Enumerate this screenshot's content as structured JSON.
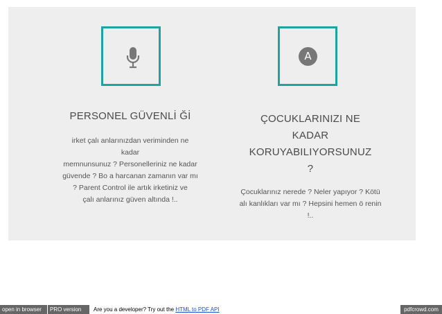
{
  "colors": {
    "accent": "#1fa3a0",
    "panel_bg": "#eeeeee",
    "title": "#4a4a4a",
    "footer_bg": "#666666"
  },
  "cards": [
    {
      "icon": "microphone-icon",
      "title": "PERSONEL GÜVENLİ Ğİ",
      "description_lines": [
        "irket çalı anlarınızdan veriminden ne kadar",
        "memnunsunuz ? Personelleriniz ne kadar",
        "güvende ? Bo a harcanan zamanın var mı",
        "? Parent Control ile artık irketiniz ve",
        "çalı anlarınız güven altında !.."
      ]
    },
    {
      "icon": "avatar-a-icon",
      "icon_letter": "A",
      "title_lines": [
        "ÇOCUKLARINIZI NE",
        "KADAR",
        "KORUYABILIYORSUNUZ",
        "?"
      ],
      "description_lines": [
        "Çocuklarınız nerede ? Neler yapıyor ? Kötü",
        "alı kanlıkları var mı ? Hepsini hemen ö renin",
        "!.."
      ]
    }
  ],
  "footer": {
    "open_in_browser": "open in browser",
    "pro_version": "PRO version",
    "promo_text": "Are you a developer? Try out the",
    "promo_link": "HTML to PDF API",
    "brand": "pdfcrowd.com"
  }
}
